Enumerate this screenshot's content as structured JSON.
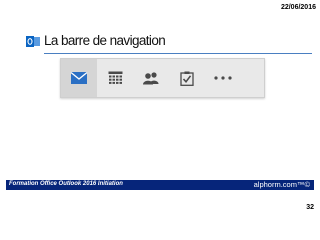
{
  "slide": {
    "date": "22/06/2016",
    "title": "La barre de navigation",
    "page_number": "32"
  },
  "navigation_bar": {
    "items": [
      {
        "icon": "mail-icon",
        "active": true
      },
      {
        "icon": "calendar-icon",
        "active": false
      },
      {
        "icon": "people-icon",
        "active": false
      },
      {
        "icon": "tasks-icon",
        "active": false
      },
      {
        "icon": "more-icon",
        "active": false
      }
    ]
  },
  "footer": {
    "course": "Formation Office Outlook 2016 Initiation",
    "brand": "alphorm.com™©"
  },
  "colors": {
    "footer_background": "#06257a",
    "title_rule": "#4a7fc1",
    "icon": "#4a4a4a",
    "mail_icon": "#2a6fc4",
    "outlook_logo": "#0a64c2"
  }
}
